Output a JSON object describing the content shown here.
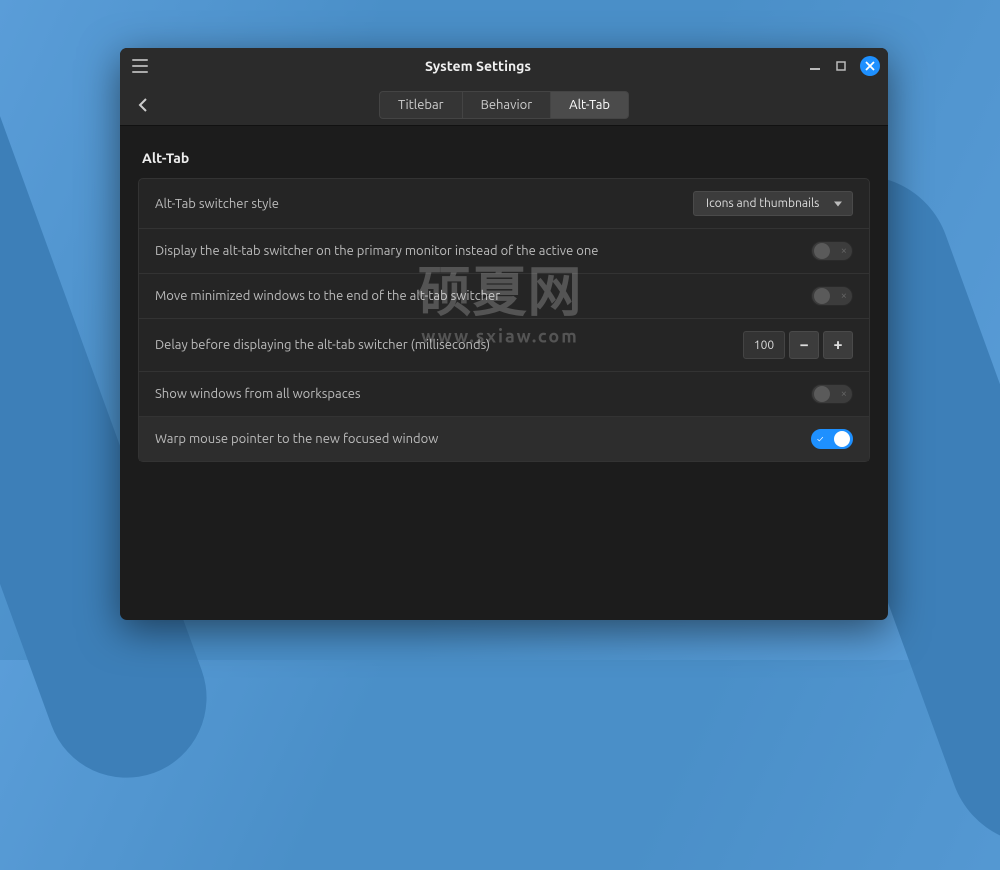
{
  "window": {
    "title": "System Settings"
  },
  "tabs": {
    "items": [
      "Titlebar",
      "Behavior",
      "Alt-Tab"
    ],
    "activeIndex": 2
  },
  "section": {
    "title": "Alt-Tab"
  },
  "settings": {
    "switcherStyle": {
      "label": "Alt-Tab switcher style",
      "selected": "Icons and thumbnails"
    },
    "primaryMonitor": {
      "label": "Display the alt-tab switcher on the primary monitor instead of the active one",
      "value": false
    },
    "moveMinimized": {
      "label": "Move minimized windows to the end of the alt-tab switcher",
      "value": false
    },
    "delay": {
      "label": "Delay before displaying the alt-tab switcher (milliseconds)",
      "value": "100"
    },
    "allWorkspaces": {
      "label": "Show windows from all workspaces",
      "value": false
    },
    "warpPointer": {
      "label": "Warp mouse pointer to the new focused window",
      "value": true
    }
  },
  "watermark": {
    "text": "硕夏网",
    "url": "www.sxiaw.com"
  }
}
